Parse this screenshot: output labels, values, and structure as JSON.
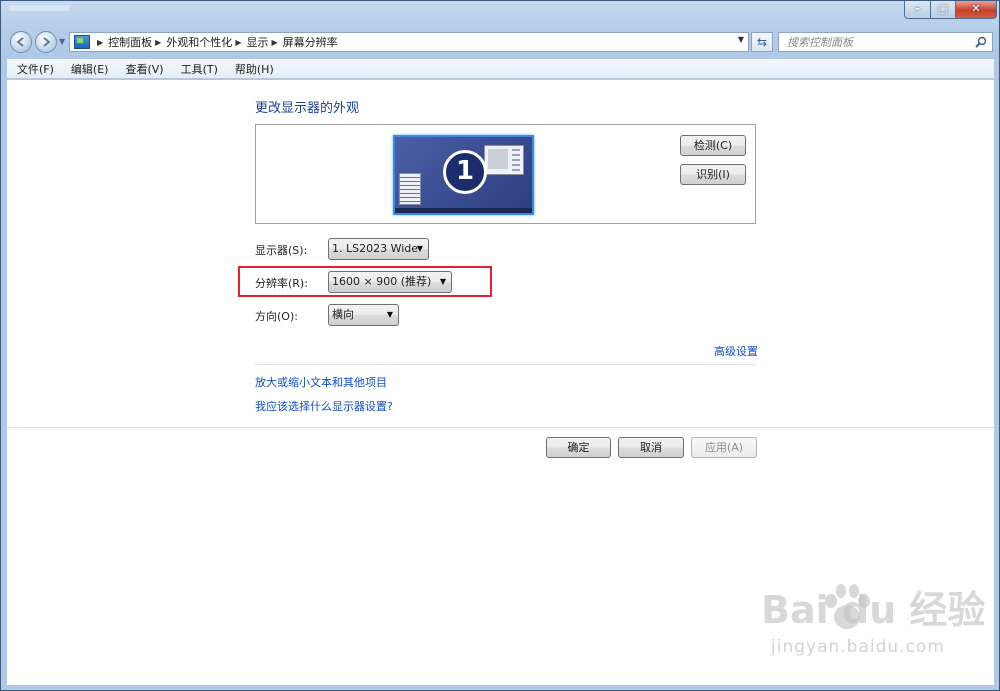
{
  "window": {
    "controls": {
      "minimize": "–",
      "maximize": "□",
      "close": "✕"
    }
  },
  "nav": {
    "breadcrumbs": [
      "控制面板",
      "外观和个性化",
      "显示",
      "屏幕分辨率"
    ],
    "search_placeholder": "搜索控制面板"
  },
  "menu": {
    "items": [
      "文件(F)",
      "编辑(E)",
      "查看(V)",
      "工具(T)",
      "帮助(H)"
    ]
  },
  "main": {
    "title": "更改显示器的外观",
    "monitor_number": "1",
    "detect_button": "检测(C)",
    "identify_button": "识别(I)",
    "display_label": "显示器(S):",
    "display_value": "1. LS2023 Wide",
    "resolution_label": "分辨率(R):",
    "resolution_value": "1600 × 900 (推荐)",
    "orientation_label": "方向(O):",
    "orientation_value": "横向",
    "advanced_link": "高级设置",
    "text_size_link": "放大或缩小文本和其他项目",
    "which_settings_link": "我应该选择什么显示器设置?",
    "ok_button": "确定",
    "cancel_button": "取消",
    "apply_button": "应用(A)"
  },
  "watermark": {
    "brand": "Bai  du 经验",
    "url": "jingyan.baidu.com"
  },
  "colors": {
    "link": "#0f4ec8",
    "title": "#1c3f94",
    "highlight": "#e5202e"
  }
}
